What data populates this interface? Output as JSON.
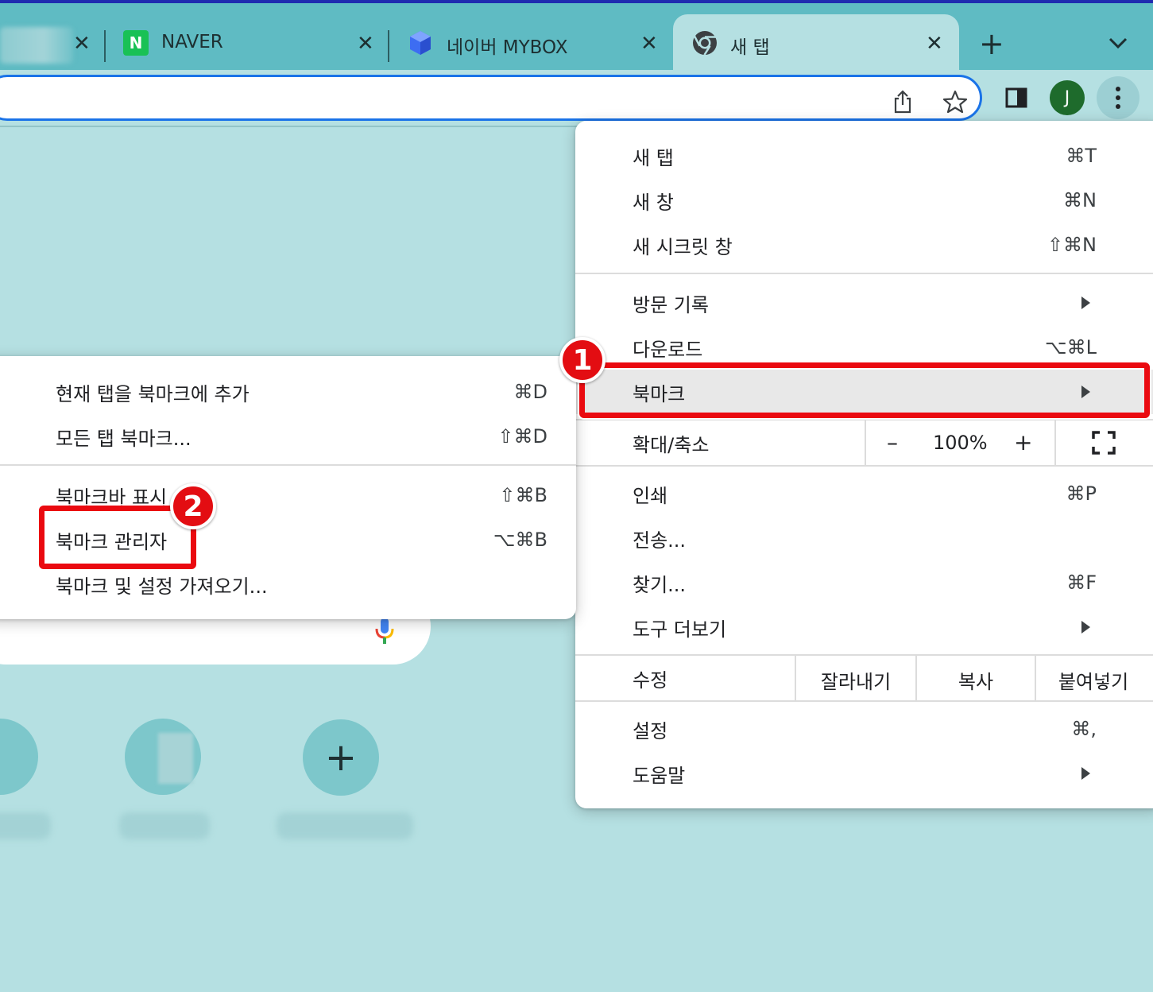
{
  "tabs": [
    {
      "title": "",
      "close": "✕"
    },
    {
      "title": "NAVER",
      "favicon": "N",
      "close": "✕"
    },
    {
      "title": "네이버 MYBOX",
      "close": "✕"
    },
    {
      "title": "새 탭",
      "close": "✕"
    }
  ],
  "tabstrip": {
    "new_tab": "+"
  },
  "profile": {
    "initial": "J"
  },
  "main_menu": {
    "new_tab": {
      "label": "새 탭",
      "shortcut": "⌘T"
    },
    "new_window": {
      "label": "새 창",
      "shortcut": "⌘N"
    },
    "new_incognito": {
      "label": "새 시크릿 창",
      "shortcut": "⇧⌘N"
    },
    "history": {
      "label": "방문 기록"
    },
    "downloads": {
      "label": "다운로드",
      "shortcut": "⌥⌘L"
    },
    "bookmarks": {
      "label": "북마크"
    },
    "zoom": {
      "label": "확대/축소",
      "minus": "–",
      "value": "100%",
      "plus": "+"
    },
    "print": {
      "label": "인쇄",
      "shortcut": "⌘P"
    },
    "cast": {
      "label": "전송..."
    },
    "find": {
      "label": "찾기...",
      "shortcut": "⌘F"
    },
    "more_tools": {
      "label": "도구 더보기"
    },
    "edit": {
      "label": "수정",
      "cut": "잘라내기",
      "copy": "복사",
      "paste": "붙여넣기"
    },
    "settings": {
      "label": "설정",
      "shortcut": "⌘,"
    },
    "help": {
      "label": "도움말"
    }
  },
  "bookmark_submenu": {
    "add_current": {
      "label": "현재 탭을 북마크에 추가",
      "shortcut": "⌘D"
    },
    "bookmark_all": {
      "label": "모든 탭 북마크...",
      "shortcut": "⇧⌘D"
    },
    "show_bar": {
      "label": "북마크바 표시",
      "shortcut": "⇧⌘B"
    },
    "manager": {
      "label": "북마크 관리자",
      "shortcut": "⌥⌘B"
    },
    "import": {
      "label": "북마크 및 설정 가져오기..."
    }
  },
  "annotations": {
    "step1": "1",
    "step2": "2",
    "color": "#ea0a10"
  },
  "shortcuts": {
    "add": "+"
  },
  "colors": {
    "background": "#b5e0e2",
    "tabstrip": "#5fbbc3",
    "accent": "#1a73e8",
    "avatar": "#1e6b2c"
  }
}
